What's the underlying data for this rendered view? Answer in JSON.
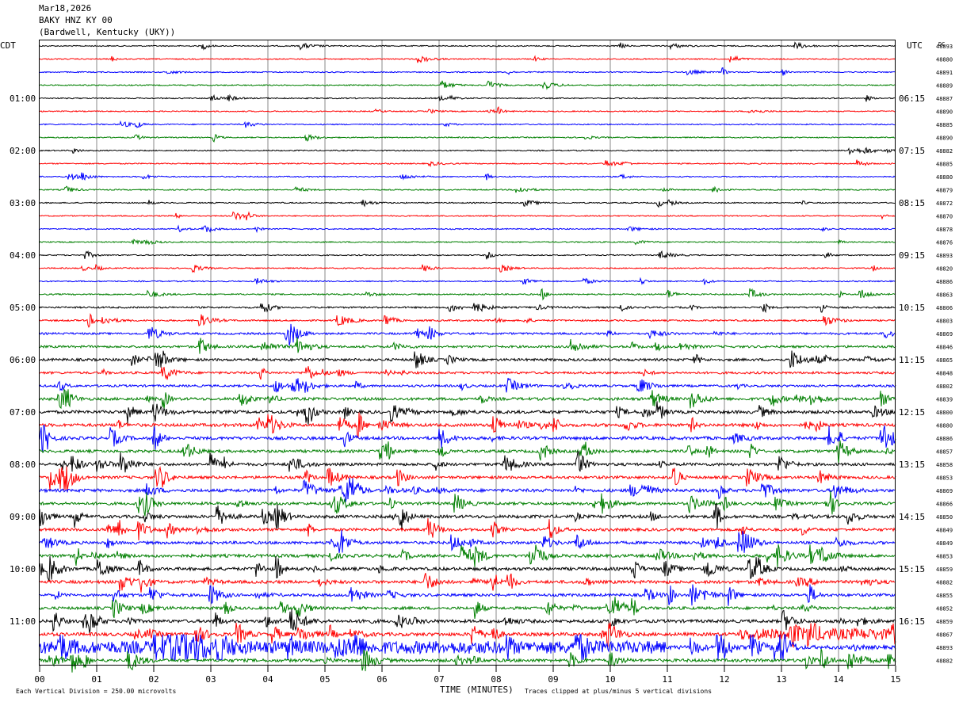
{
  "header": {
    "date": "Mar18,2026",
    "station": "BAKY HNZ KY 00",
    "location": "(Bardwell, Kentucky (UKY))"
  },
  "labels": {
    "left_tz": "CDT",
    "right_tz": "UTC",
    "dc_label": "DC"
  },
  "footer": {
    "scale_note": "Each Vertical Division =  250.00 microvolts",
    "clip_note": "Traces clipped at plus/minus 5 vertical divisions",
    "xlabel": "TIME (MINUTES)"
  },
  "chart_data": {
    "type": "line",
    "xlabel": "TIME (MINUTES)",
    "xlim": [
      0,
      15
    ],
    "x_ticks": [
      "00",
      "01",
      "02",
      "03",
      "04",
      "05",
      "06",
      "07",
      "08",
      "09",
      "10",
      "11",
      "12",
      "13",
      "14",
      "15"
    ],
    "trace_count": 48,
    "trace_colors": [
      "#000000",
      "#ff0000",
      "#0000ff",
      "#007f00"
    ],
    "left_hour_labels": [
      {
        "trace": 4,
        "label": "01:00"
      },
      {
        "trace": 8,
        "label": "02:00"
      },
      {
        "trace": 12,
        "label": "03:00"
      },
      {
        "trace": 16,
        "label": "04:00"
      },
      {
        "trace": 20,
        "label": "05:00"
      },
      {
        "trace": 24,
        "label": "06:00"
      },
      {
        "trace": 28,
        "label": "07:00"
      },
      {
        "trace": 32,
        "label": "08:00"
      },
      {
        "trace": 36,
        "label": "09:00"
      },
      {
        "trace": 40,
        "label": "10:00"
      },
      {
        "trace": 44,
        "label": "11:00"
      }
    ],
    "right_hour_labels": [
      {
        "trace": 4,
        "label": "06:15"
      },
      {
        "trace": 8,
        "label": "07:15"
      },
      {
        "trace": 12,
        "label": "08:15"
      },
      {
        "trace": 16,
        "label": "09:15"
      },
      {
        "trace": 20,
        "label": "10:15"
      },
      {
        "trace": 24,
        "label": "11:15"
      },
      {
        "trace": 28,
        "label": "12:15"
      },
      {
        "trace": 32,
        "label": "13:15"
      },
      {
        "trace": 36,
        "label": "14:15"
      },
      {
        "trace": 40,
        "label": "15:15"
      },
      {
        "trace": 44,
        "label": "16:15"
      }
    ],
    "dc_offsets": [
      "48893",
      "48880",
      "48891",
      "48889",
      "48887",
      "48890",
      "48885",
      "48890",
      "48882",
      "48885",
      "48880",
      "48879",
      "48872",
      "48870",
      "48878",
      "48876",
      "48893",
      "48820",
      "48886",
      "48863",
      "48806",
      "48803",
      "48869",
      "48846",
      "48865",
      "48848",
      "48802",
      "48839",
      "48800",
      "48880",
      "48886",
      "48857",
      "48858",
      "48853",
      "48869",
      "48866",
      "48850",
      "48849",
      "48849",
      "48853",
      "48859",
      "48882",
      "48855",
      "48852",
      "48859",
      "48867",
      "48893",
      "48882"
    ],
    "activity": [
      1,
      1,
      1,
      1,
      1,
      1,
      1,
      1,
      1,
      1,
      1,
      1,
      1,
      1,
      1,
      1,
      1,
      1,
      1,
      1.5,
      2,
      2,
      2.5,
      3,
      3.5,
      3,
      3,
      4,
      4.5,
      4.5,
      4.5,
      4,
      4,
      4,
      4.5,
      4,
      4.5,
      4,
      4,
      4.5,
      4.5,
      4.5,
      4,
      4,
      4.5,
      5,
      6,
      4.5
    ]
  }
}
